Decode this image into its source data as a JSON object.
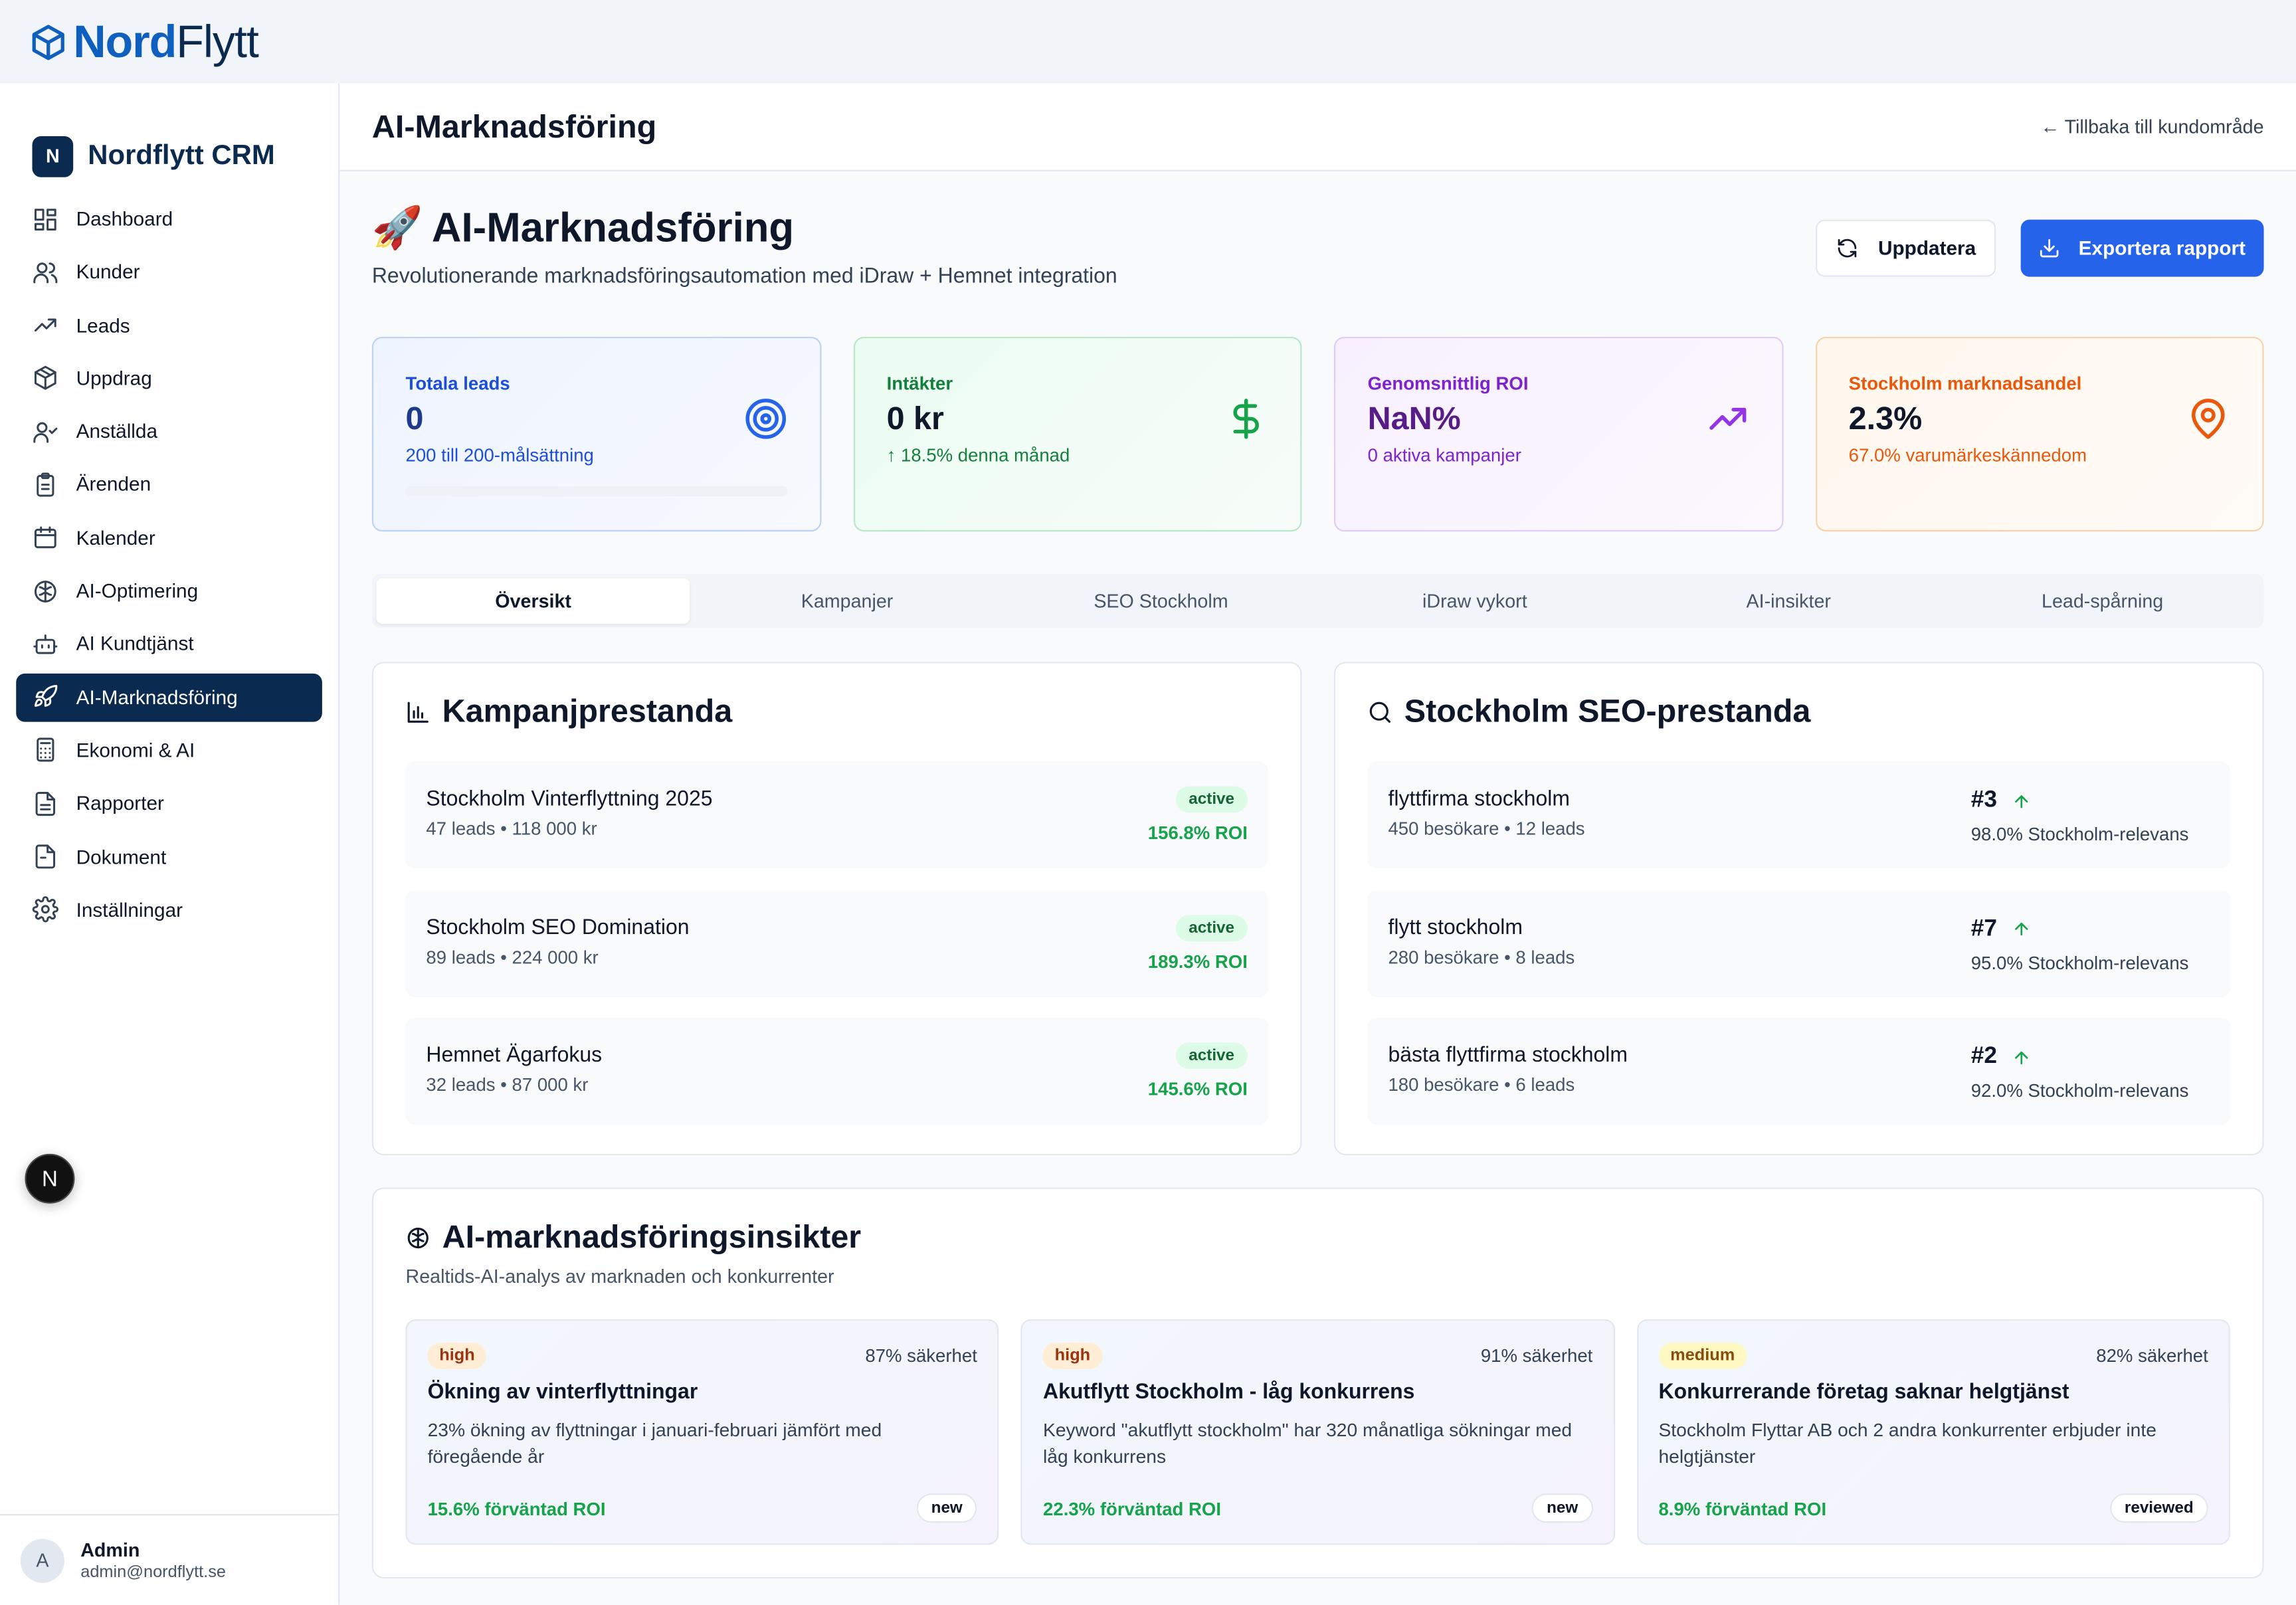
{
  "brand": {
    "part1": "Nord",
    "part2": "Flytt"
  },
  "sidebar": {
    "logo_letter": "N",
    "title": "Nordflytt CRM",
    "items": [
      {
        "label": "Dashboard"
      },
      {
        "label": "Kunder"
      },
      {
        "label": "Leads"
      },
      {
        "label": "Uppdrag"
      },
      {
        "label": "Anställda"
      },
      {
        "label": "Ärenden"
      },
      {
        "label": "Kalender"
      },
      {
        "label": "AI-Optimering"
      },
      {
        "label": "AI Kundtjänst"
      },
      {
        "label": "AI-Marknadsföring"
      },
      {
        "label": "Ekonomi & AI"
      },
      {
        "label": "Rapporter"
      },
      {
        "label": "Dokument"
      },
      {
        "label": "Inställningar"
      }
    ],
    "active_item": "AI-Marknadsföring",
    "next_badge": "N",
    "user": {
      "avatar": "A",
      "name": "Admin",
      "email": "admin@nordflytt.se"
    }
  },
  "header": {
    "title": "AI-Marknadsföring",
    "back_link": "← Tillbaka till kundområde"
  },
  "hero": {
    "emoji": "🚀",
    "title": "AI-Marknadsföring",
    "subtitle": "Revolutionerande marknadsföringsautomation med iDraw + Hemnet integration",
    "refresh_label": "Uppdatera",
    "export_label": "Exportera rapport"
  },
  "stats": {
    "leads": {
      "label": "Totala leads",
      "value": "0",
      "sub": "200 till 200-målsättning",
      "progress": 0
    },
    "revenue": {
      "label": "Intäkter",
      "value": "0 kr",
      "sub": "↑ 18.5% denna månad"
    },
    "roi": {
      "label": "Genomsnittlig ROI",
      "value": "NaN%",
      "sub": "0 aktiva kampanjer"
    },
    "share": {
      "label": "Stockholm marknadsandel",
      "value": "2.3%",
      "sub": "67.0% varumärkeskännedom"
    }
  },
  "tabs": [
    "Översikt",
    "Kampanjer",
    "SEO Stockholm",
    "iDraw vykort",
    "AI-insikter",
    "Lead-spårning"
  ],
  "campaigns": {
    "title": "Kampanjprestanda",
    "items": [
      {
        "name": "Stockholm Vinterflyttning 2025",
        "meta": "47 leads • 118 000 kr",
        "status": "active",
        "roi": "156.8% ROI"
      },
      {
        "name": "Stockholm SEO Domination",
        "meta": "89 leads • 224 000 kr",
        "status": "active",
        "roi": "189.3% ROI"
      },
      {
        "name": "Hemnet Ägarfokus",
        "meta": "32 leads • 87 000 kr",
        "status": "active",
        "roi": "145.6% ROI"
      }
    ]
  },
  "seo": {
    "title": "Stockholm SEO-prestanda",
    "items": [
      {
        "keyword": "flyttfirma stockholm",
        "meta": "450 besökare • 12 leads",
        "rank": "#3",
        "relevance": "98.0% Stockholm-relevans"
      },
      {
        "keyword": "flytt stockholm",
        "meta": "280 besökare • 8 leads",
        "rank": "#7",
        "relevance": "95.0% Stockholm-relevans"
      },
      {
        "keyword": "bästa flyttfirma stockholm",
        "meta": "180 besökare • 6 leads",
        "rank": "#2",
        "relevance": "92.0% Stockholm-relevans"
      }
    ]
  },
  "insights": {
    "title": "AI-marknadsföringsinsikter",
    "subtitle": "Realtids-AI-analys av marknaden och konkurrenter",
    "cards": [
      {
        "priority": "high",
        "confidence": "87% säkerhet",
        "title": "Ökning av vinterflyttningar",
        "description": "23% ökning av flyttningar i januari-februari jämfört med föregående år",
        "roi": "15.6% förväntad ROI",
        "status": "new"
      },
      {
        "priority": "high",
        "confidence": "91% säkerhet",
        "title": "Akutflytt Stockholm - låg konkurrens",
        "description": "Keyword \"akutflytt stockholm\" har 320 månatliga sökningar med låg konkurrens",
        "roi": "22.3% förväntad ROI",
        "status": "new"
      },
      {
        "priority": "medium",
        "confidence": "82% säkerhet",
        "title": "Konkurrerande företag saknar helgtjänst",
        "description": "Stockholm Flyttar AB och 2 andra konkurrenter erbjuder inte helgtjänster",
        "roi": "8.9% förväntad ROI",
        "status": "reviewed"
      }
    ]
  },
  "colors": {
    "brand_navy": "#0b2a4f",
    "primary_blue": "#2563eb",
    "success_green": "#16a34a",
    "purple": "#7e22ce",
    "orange": "#ea580c"
  }
}
